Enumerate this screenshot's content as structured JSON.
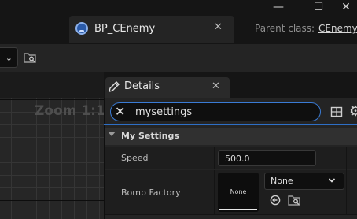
{
  "window": {
    "minimize_glyph": "—",
    "maximize_glyph": "☐",
    "close_glyph": "✕"
  },
  "document_tab": {
    "label": "BP_CEnemy",
    "close_glyph": "✕",
    "icon": "blueprint-icon"
  },
  "parent_class": {
    "label": "Parent class:",
    "value": "CEnemy"
  },
  "toolbar": {
    "dropdown_chevron": "⌄",
    "browse_icon": "folder-search-icon"
  },
  "graph": {
    "zoom_label": "Zoom 1:1"
  },
  "details": {
    "title": "Details",
    "close_glyph": "✕",
    "icon": "pencil-icon",
    "search": {
      "value": "mysettings",
      "clear_glyph": "✕"
    },
    "category": {
      "label": "My Settings"
    },
    "properties": {
      "speed": {
        "label": "Speed",
        "value": "500.0"
      },
      "bomb_factory": {
        "label": "Bomb Factory",
        "thumbnail_text": "None",
        "asset_value": "None"
      }
    }
  },
  "colors": {
    "accent": "#2e6fc6",
    "background": "#151515",
    "panel": "#242424"
  }
}
